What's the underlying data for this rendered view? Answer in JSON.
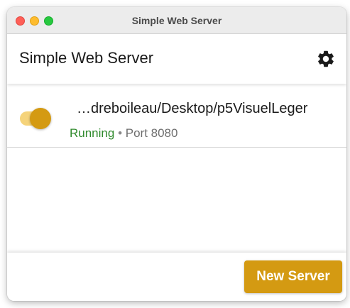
{
  "window": {
    "title": "Simple Web Server"
  },
  "header": {
    "title": "Simple Web Server",
    "settings_icon": "gear-icon"
  },
  "servers": [
    {
      "path": "…dreboileau/Desktop/p5VisuelLeger",
      "enabled": true,
      "status": "Running",
      "separator": "•",
      "port_label": "Port 8080"
    }
  ],
  "footer": {
    "new_server_label": "New Server"
  },
  "colors": {
    "accent": "#d49a12",
    "toggle_track": "#f5d37a",
    "running": "#2f8a2c"
  }
}
